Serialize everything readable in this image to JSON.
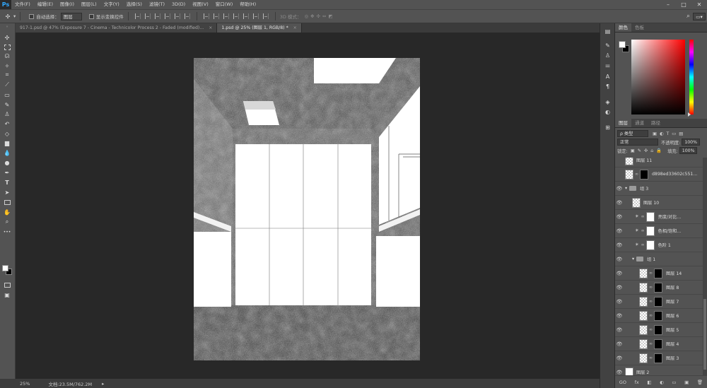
{
  "app": {
    "logo": "Ps"
  },
  "menu": [
    "文件(F)",
    "编辑(E)",
    "图像(I)",
    "图层(L)",
    "文字(Y)",
    "选择(S)",
    "滤镜(T)",
    "3D(D)",
    "视图(V)",
    "窗口(W)",
    "帮助(H)"
  ],
  "window_controls": [
    "–",
    "□",
    "✕"
  ],
  "options": {
    "auto_select_label": "自动选择：",
    "auto_select_value": "图层",
    "show_transform_label": "显示变换控件",
    "mode_3d_label": "3D 模式："
  },
  "tabs": [
    {
      "label": "917-1.psd @ 47% (Exposure 7 - Cinema - Technicolor Process 2 - Faded (modified)...",
      "close": "×",
      "active": false
    },
    {
      "label": "1.psd @ 25% (图层 1, RGB/8) *",
      "close": "×",
      "active": true
    }
  ],
  "status": {
    "zoom": "25%",
    "doc_info": "文档:23.5M/762.2M"
  },
  "color_panel": {
    "tabs": [
      "颜色",
      "色板"
    ],
    "foreground": "#ffffff",
    "background": "#000000"
  },
  "layers_panel": {
    "tabs": [
      "图层",
      "通道",
      "路径"
    ],
    "filter_kind": "ρ 类型",
    "blend_mode": "正常",
    "opacity_label": "不透明度:",
    "opacity_value": "100%",
    "lock_label": "锁定:",
    "fill_label": "填充:",
    "fill_value": "100%",
    "layers": [
      {
        "name": "图层 11",
        "indent": 0,
        "visible": false,
        "kind": "pixel"
      },
      {
        "name": "d898ed33602c551...",
        "indent": 0,
        "visible": false,
        "kind": "masked"
      },
      {
        "name": "组 3",
        "indent": 0,
        "visible": true,
        "kind": "group"
      },
      {
        "name": "图层 10",
        "indent": 1,
        "visible": true,
        "kind": "pixel"
      },
      {
        "name": "亮度/对比...",
        "indent": 1,
        "visible": true,
        "kind": "adjust"
      },
      {
        "name": "色相/饱和...",
        "indent": 1,
        "visible": true,
        "kind": "adjust"
      },
      {
        "name": "色阶 1",
        "indent": 1,
        "visible": true,
        "kind": "adjust"
      },
      {
        "name": "组 1",
        "indent": 1,
        "visible": true,
        "kind": "group"
      },
      {
        "name": "图层 14",
        "indent": 2,
        "visible": true,
        "kind": "masked"
      },
      {
        "name": "图层 8",
        "indent": 2,
        "visible": true,
        "kind": "masked"
      },
      {
        "name": "图层 7",
        "indent": 2,
        "visible": true,
        "kind": "masked"
      },
      {
        "name": "图层 6",
        "indent": 2,
        "visible": true,
        "kind": "masked"
      },
      {
        "name": "图层 5",
        "indent": 2,
        "visible": true,
        "kind": "masked"
      },
      {
        "name": "图层 4",
        "indent": 2,
        "visible": true,
        "kind": "masked"
      },
      {
        "name": "图层 3",
        "indent": 2,
        "visible": true,
        "kind": "masked"
      },
      {
        "name": "图层 2",
        "indent": 0,
        "visible": true,
        "kind": "white"
      }
    ],
    "footer_icons": [
      "GO",
      "fx",
      "◧",
      "◐",
      "▭",
      "▣",
      "🗑"
    ]
  }
}
